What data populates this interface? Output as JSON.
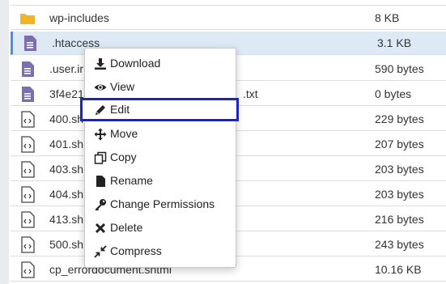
{
  "files": [
    {
      "name": "wp-includes",
      "size": "8 KB",
      "icon": "folder-icon"
    },
    {
      "name": ".htaccess",
      "size": "3.1 KB",
      "icon": "text-file-icon"
    },
    {
      "name": ".user.ir",
      "size": "590 bytes",
      "icon": "text-file-icon"
    },
    {
      "name": "3f4e21",
      "name_tail": ".txt",
      "size": "0 bytes",
      "icon": "text-file-icon"
    },
    {
      "name": "400.sh",
      "size": "229 bytes",
      "icon": "code-file-icon"
    },
    {
      "name": "401.sh",
      "size": "207 bytes",
      "icon": "code-file-icon"
    },
    {
      "name": "403.sh",
      "size": "203 bytes",
      "icon": "code-file-icon"
    },
    {
      "name": "404.sh",
      "size": "203 bytes",
      "icon": "code-file-icon"
    },
    {
      "name": "413.sh",
      "size": "216 bytes",
      "icon": "code-file-icon"
    },
    {
      "name": "500.sh",
      "size": "243 bytes",
      "icon": "code-file-icon"
    },
    {
      "name": "cp_errordocument.shtml",
      "size": "10.16 KB",
      "icon": "code-file-icon"
    }
  ],
  "context_menu": {
    "items": [
      {
        "label": "Download",
        "icon": "download-icon"
      },
      {
        "label": "View",
        "icon": "eye-icon"
      },
      {
        "label": "Edit",
        "icon": "pencil-icon"
      },
      {
        "label": "Move",
        "icon": "move-arrows-icon"
      },
      {
        "label": "Copy",
        "icon": "copy-icon"
      },
      {
        "label": "Rename",
        "icon": "file-icon"
      },
      {
        "label": "Change Permissions",
        "icon": "key-icon"
      },
      {
        "label": "Delete",
        "icon": "x-icon"
      },
      {
        "label": "Compress",
        "icon": "compress-icon"
      }
    ],
    "highlighted_item": "Edit"
  },
  "colors": {
    "selected_row": "#ddeaf5",
    "highlight_border": "#1a25c9",
    "folder": "#f0b429",
    "text_file_icon": "#7b6fb0"
  }
}
